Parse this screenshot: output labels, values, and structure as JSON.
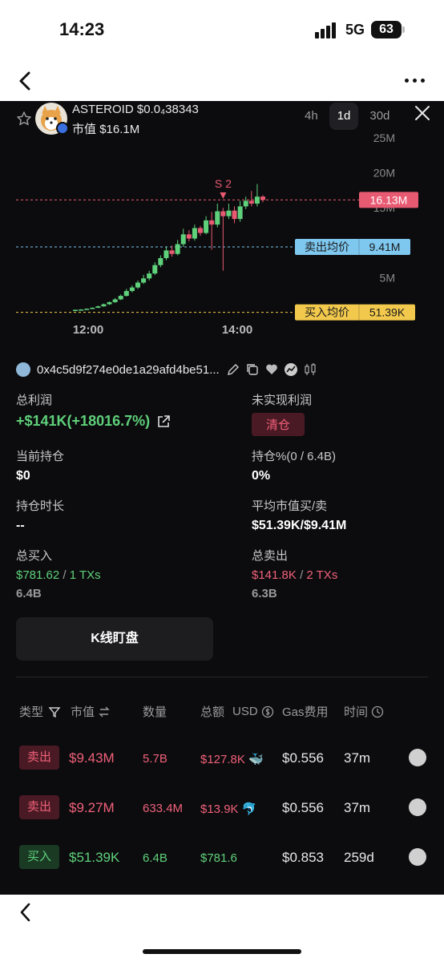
{
  "status": {
    "time": "14:23",
    "network": "5G",
    "battery": "63"
  },
  "nav": {
    "back_icon": "chevron-left-icon",
    "more_icon": "more-dots-icon"
  },
  "token": {
    "name": "ASTEROID",
    "price": "$0.0₄38343",
    "mcap_label": "市值",
    "mcap": "$16.1M"
  },
  "timeframes": [
    {
      "label": "4h",
      "active": false
    },
    {
      "label": "1d",
      "active": true
    },
    {
      "label": "30d",
      "active": false
    }
  ],
  "chart_data": {
    "type": "candlestick",
    "x_ticks": [
      "12:00",
      "14:00"
    ],
    "y_ticks": [
      "5M",
      "10M",
      "15M",
      "20M",
      "25M"
    ],
    "ylim": [
      0,
      25000000
    ],
    "candles_mcap_m": [
      [
        0.35,
        0.4,
        0.3,
        0.45
      ],
      [
        0.4,
        0.45,
        0.38,
        0.5
      ],
      [
        0.45,
        0.55,
        0.42,
        0.6
      ],
      [
        0.55,
        0.7,
        0.5,
        0.75
      ],
      [
        0.7,
        0.9,
        0.65,
        1.0
      ],
      [
        0.9,
        1.2,
        0.85,
        1.3
      ],
      [
        1.2,
        1.5,
        1.1,
        1.6
      ],
      [
        1.5,
        1.9,
        1.4,
        2.1
      ],
      [
        1.9,
        2.4,
        1.8,
        2.6
      ],
      [
        2.4,
        3.1,
        2.3,
        3.4
      ],
      [
        3.1,
        3.6,
        2.9,
        3.9
      ],
      [
        3.6,
        4.3,
        3.4,
        4.6
      ],
      [
        4.3,
        4.9,
        4.1,
        5.4
      ],
      [
        4.9,
        5.6,
        4.6,
        6.0
      ],
      [
        5.6,
        6.8,
        5.4,
        7.2
      ],
      [
        6.8,
        7.8,
        6.5,
        8.2
      ],
      [
        7.8,
        8.9,
        7.5,
        9.4
      ],
      [
        8.9,
        8.4,
        8.0,
        9.6
      ],
      [
        8.4,
        9.8,
        8.2,
        10.4
      ],
      [
        9.8,
        11.2,
        9.4,
        12.0
      ],
      [
        11.2,
        10.6,
        10.2,
        11.8
      ],
      [
        10.6,
        12.1,
        10.3,
        12.6
      ],
      [
        12.1,
        11.4,
        11.0,
        12.4
      ],
      [
        11.4,
        13.2,
        11.2,
        13.8
      ],
      [
        13.2,
        12.6,
        9.0,
        14.4
      ],
      [
        12.6,
        14.5,
        12.2,
        15.6
      ],
      [
        14.5,
        13.8,
        6.0,
        15.0
      ],
      [
        13.8,
        14.6,
        13.4,
        15.6
      ],
      [
        14.6,
        13.4,
        12.8,
        15.2
      ],
      [
        13.4,
        15.2,
        13.0,
        16.0
      ],
      [
        15.2,
        16.0,
        14.8,
        16.6
      ],
      [
        16.0,
        15.6,
        15.2,
        17.4
      ],
      [
        15.6,
        16.6,
        15.2,
        18.4
      ],
      [
        16.6,
        16.13,
        15.8,
        16.8
      ]
    ],
    "lines": [
      {
        "label": "",
        "value": "16.13M",
        "num": 16130000,
        "color": "#e85a72"
      },
      {
        "label": "卖出均价",
        "value": "9.41M",
        "num": 9410000,
        "color": "#7ec8f0"
      },
      {
        "label": "买入均价",
        "value": "51.39K",
        "num": 51390,
        "color": "#f2c94c"
      }
    ],
    "marker": {
      "label": "S 2",
      "at_candle": 26
    }
  },
  "wallet": {
    "address": "0x4c5d9f274e0de1a29afd4be51..."
  },
  "stats": {
    "total_profit_label": "总利润",
    "total_profit": "+$141K(+18016.7%)",
    "unrealized_label": "未实现利润",
    "clear_label": "清仓",
    "holding_label": "当前持仓",
    "holding": "$0",
    "holding_pct_label": "持仓%(0 / 6.4B)",
    "holding_pct": "0%",
    "duration_label": "持仓时长",
    "duration": "--",
    "avg_mcap_label": "平均市值买/卖",
    "avg_mcap": "$51.39K/$9.41M",
    "total_buy_label": "总买入",
    "total_buy": "$781.62",
    "total_buy_tx": "1 TXs",
    "total_buy_qty": "6.4B",
    "total_sell_label": "总卖出",
    "total_sell": "$141.8K",
    "total_sell_tx": "2 TXs",
    "total_sell_qty": "6.3B",
    "slash": "/"
  },
  "kline_button": "K线盯盘",
  "table": {
    "headers": {
      "type": "类型",
      "mcap": "市值",
      "qty": "数量",
      "total": "总额",
      "usd": "USD",
      "gas": "Gas费用",
      "time": "时间"
    },
    "rows": [
      {
        "type": "卖出",
        "kind": "sell",
        "mcap": "$9.43M",
        "qty": "5.7B",
        "total": "$127.8K",
        "gas": "$0.556",
        "time": "37m"
      },
      {
        "type": "卖出",
        "kind": "sell",
        "mcap": "$9.27M",
        "qty": "633.4M",
        "total": "$13.9K",
        "gas": "$0.556",
        "time": "37m"
      },
      {
        "type": "买入",
        "kind": "buy",
        "mcap": "$51.39K",
        "qty": "6.4B",
        "total": "$781.6",
        "gas": "$0.853",
        "time": "259d"
      }
    ]
  }
}
